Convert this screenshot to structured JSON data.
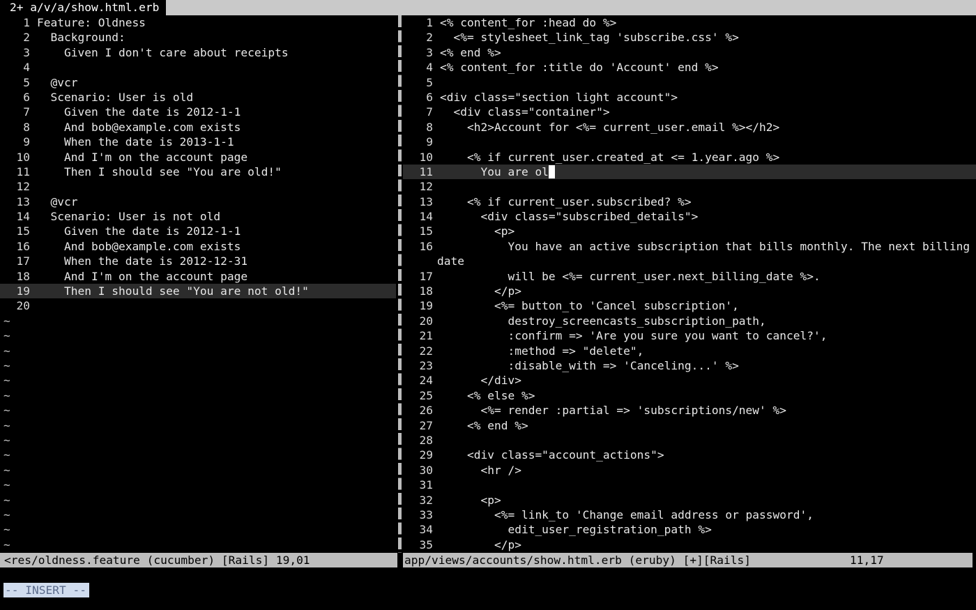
{
  "tabline": {
    "active_tab": "2+ a/v/a/show.html.erb"
  },
  "left_pane": {
    "lines": [
      {
        "n": "1",
        "text": "Feature: Oldness"
      },
      {
        "n": "2",
        "text": "  Background:"
      },
      {
        "n": "3",
        "text": "    Given I don't care about receipts"
      },
      {
        "n": "4",
        "text": ""
      },
      {
        "n": "5",
        "text": "  @vcr"
      },
      {
        "n": "6",
        "text": "  Scenario: User is old"
      },
      {
        "n": "7",
        "text": "    Given the date is 2012-1-1"
      },
      {
        "n": "8",
        "text": "    And bob@example.com exists"
      },
      {
        "n": "9",
        "text": "    When the date is 2013-1-1"
      },
      {
        "n": "10",
        "text": "    And I'm on the account page"
      },
      {
        "n": "11",
        "text": "    Then I should see \"You are old!\""
      },
      {
        "n": "12",
        "text": ""
      },
      {
        "n": "13",
        "text": "  @vcr"
      },
      {
        "n": "14",
        "text": "  Scenario: User is not old"
      },
      {
        "n": "15",
        "text": "    Given the date is 2012-1-1"
      },
      {
        "n": "16",
        "text": "    And bob@example.com exists"
      },
      {
        "n": "17",
        "text": "    When the date is 2012-12-31"
      },
      {
        "n": "18",
        "text": "    And I'm on the account page"
      },
      {
        "n": "19",
        "text": "    Then I should see \"You are not old!\""
      },
      {
        "n": "20",
        "text": ""
      }
    ],
    "cursor_line": "19",
    "tilde_count": 16,
    "tilde": "~"
  },
  "right_pane": {
    "lines": [
      {
        "n": "1",
        "text": "<% content_for :head do %>"
      },
      {
        "n": "2",
        "text": "  <%= stylesheet_link_tag 'subscribe.css' %>"
      },
      {
        "n": "3",
        "text": "<% end %>"
      },
      {
        "n": "4",
        "text": "<% content_for :title do 'Account' end %>"
      },
      {
        "n": "5",
        "text": ""
      },
      {
        "n": "6",
        "text": "<div class=\"section light account\">"
      },
      {
        "n": "7",
        "text": "  <div class=\"container\">"
      },
      {
        "n": "8",
        "text": "    <h2>Account for <%= current_user.email %></h2>"
      },
      {
        "n": "9",
        "text": ""
      },
      {
        "n": "10",
        "text": "    <% if current_user.created_at <= 1.year.ago %>"
      },
      {
        "n": "11",
        "text": "      You are ol"
      },
      {
        "n": "12",
        "text": ""
      },
      {
        "n": "13",
        "text": "    <% if current_user.subscribed? %>"
      },
      {
        "n": "14",
        "text": "      <div class=\"subscribed_details\">"
      },
      {
        "n": "15",
        "text": "        <p>"
      },
      {
        "n": "16",
        "text": "          You have an active subscription that bills monthly. The next billing"
      },
      {
        "n": "",
        "text": "date"
      },
      {
        "n": "17",
        "text": "          will be <%= current_user.next_billing_date %>."
      },
      {
        "n": "18",
        "text": "        </p>"
      },
      {
        "n": "19",
        "text": "        <%= button_to 'Cancel subscription',"
      },
      {
        "n": "20",
        "text": "          destroy_screencasts_subscription_path,"
      },
      {
        "n": "21",
        "text": "          :confirm => 'Are you sure you want to cancel?',"
      },
      {
        "n": "22",
        "text": "          :method => \"delete\","
      },
      {
        "n": "23",
        "text": "          :disable_with => 'Canceling...' %>"
      },
      {
        "n": "24",
        "text": "      </div>"
      },
      {
        "n": "25",
        "text": "    <% else %>"
      },
      {
        "n": "26",
        "text": "      <%= render :partial => 'subscriptions/new' %>"
      },
      {
        "n": "27",
        "text": "    <% end %>"
      },
      {
        "n": "28",
        "text": ""
      },
      {
        "n": "29",
        "text": "    <div class=\"account_actions\">"
      },
      {
        "n": "30",
        "text": "      <hr />"
      },
      {
        "n": "31",
        "text": ""
      },
      {
        "n": "32",
        "text": "      <p>"
      },
      {
        "n": "33",
        "text": "        <%= link_to 'Change email address or password',"
      },
      {
        "n": "34",
        "text": "          edit_user_registration_path %>"
      },
      {
        "n": "35",
        "text": "        </p>"
      }
    ],
    "cursor_line": "11"
  },
  "statusline": {
    "left": "<res/oldness.feature (cucumber) [Rails] 19,01",
    "right": "app/views/accounts/show.html.erb (eruby) [+][Rails]",
    "right_pos": "11,17"
  },
  "mode": "-- INSERT --",
  "colors": {
    "background": "#000000",
    "statusline": "#bdbdbd",
    "cursorline": "#2c2c2c",
    "mode_bg": "#d0dcee"
  }
}
